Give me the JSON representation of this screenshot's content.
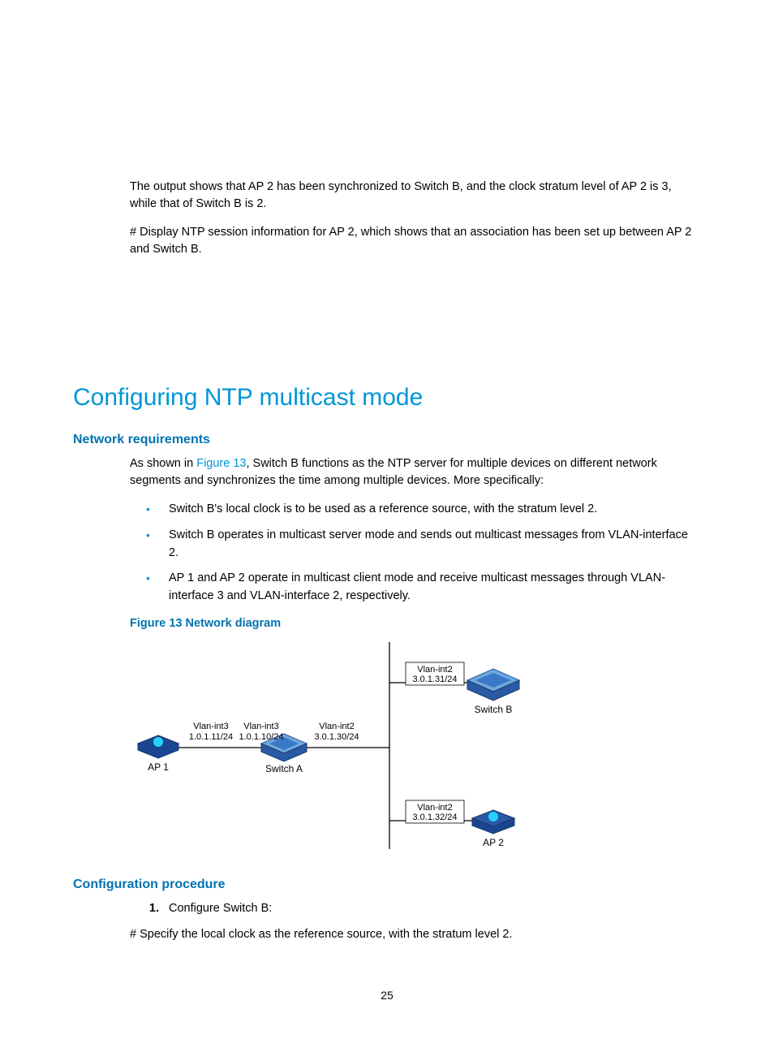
{
  "intro": {
    "p1": "The output shows that AP 2 has been synchronized to Switch B, and the clock stratum level of AP 2 is 3, while that of Switch B is 2.",
    "p2": "# Display NTP session information for AP 2, which shows that an association has been set up between AP 2 and Switch B."
  },
  "section": {
    "title": "Configuring NTP multicast mode",
    "req": {
      "heading": "Network requirements",
      "lead_pre": "As shown in ",
      "lead_link": "Figure 13",
      "lead_post": ", Switch B functions as the NTP server for multiple devices on different network segments and synchronizes the time among multiple devices. More specifically:",
      "bullets": [
        "Switch B's local clock is to be used as a reference source, with the stratum level 2.",
        "Switch B operates in multicast server mode and sends out multicast messages from VLAN-interface 2.",
        "AP 1 and AP 2 operate in multicast client mode and receive multicast messages through VLAN-interface 3 and VLAN-interface 2, respectively."
      ],
      "figcap": "Figure 13 Network diagram",
      "diagram": {
        "ap1": "AP 1",
        "ap1_if": "Vlan-int3\n1.0.1.11/24",
        "swA": "Switch A",
        "swA_left_if": "Vlan-int3\n1.0.1.10/24",
        "swA_right_if": "Vlan-int2\n3.0.1.30/24",
        "swB": "Switch B",
        "swB_if": "Vlan-int2\n3.0.1.31/24",
        "ap2": "AP 2",
        "ap2_if": "Vlan-int2\n3.0.1.32/24"
      }
    },
    "proc": {
      "heading": "Configuration procedure",
      "steps": [
        {
          "num": "1.",
          "text": "Configure Switch B:"
        }
      ],
      "after": "# Specify the local clock as the reference source, with the stratum level 2."
    }
  },
  "pagenum": "25"
}
